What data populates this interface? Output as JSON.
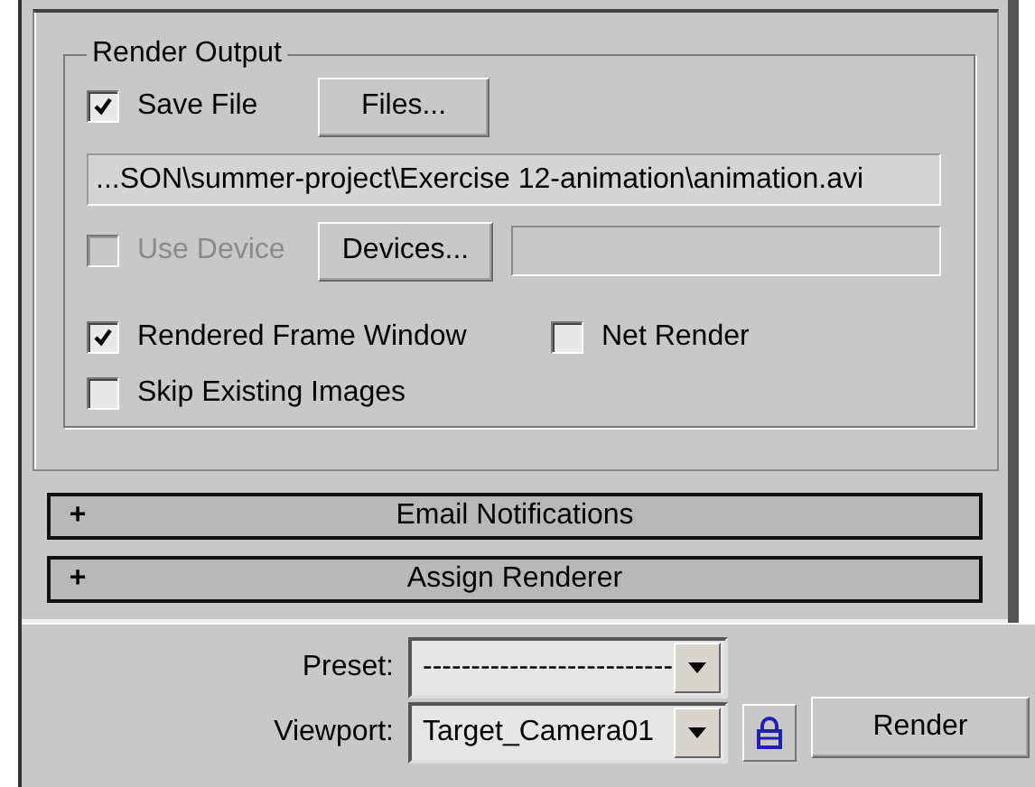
{
  "render_output": {
    "title": "Render Output",
    "save_file": {
      "label": "Save File",
      "checked": true
    },
    "files_button": "Files...",
    "path": "...SON\\summer-project\\Exercise 12-animation\\animation.avi",
    "use_device": {
      "label": "Use Device",
      "checked": false,
      "disabled": true
    },
    "devices_button": "Devices...",
    "options": [
      {
        "label": "Rendered Frame Window",
        "checked": true
      },
      {
        "label": "Net Render",
        "checked": false
      },
      {
        "label": "Skip Existing Images",
        "checked": false
      }
    ]
  },
  "rollouts": [
    {
      "sign": "+",
      "title": "Email Notifications"
    },
    {
      "sign": "+",
      "title": "Assign Renderer"
    }
  ],
  "preset": {
    "label": "Preset:",
    "value": "--------------------------"
  },
  "viewport": {
    "label": "Viewport:",
    "value": "Target_Camera01"
  },
  "render_button": "Render"
}
